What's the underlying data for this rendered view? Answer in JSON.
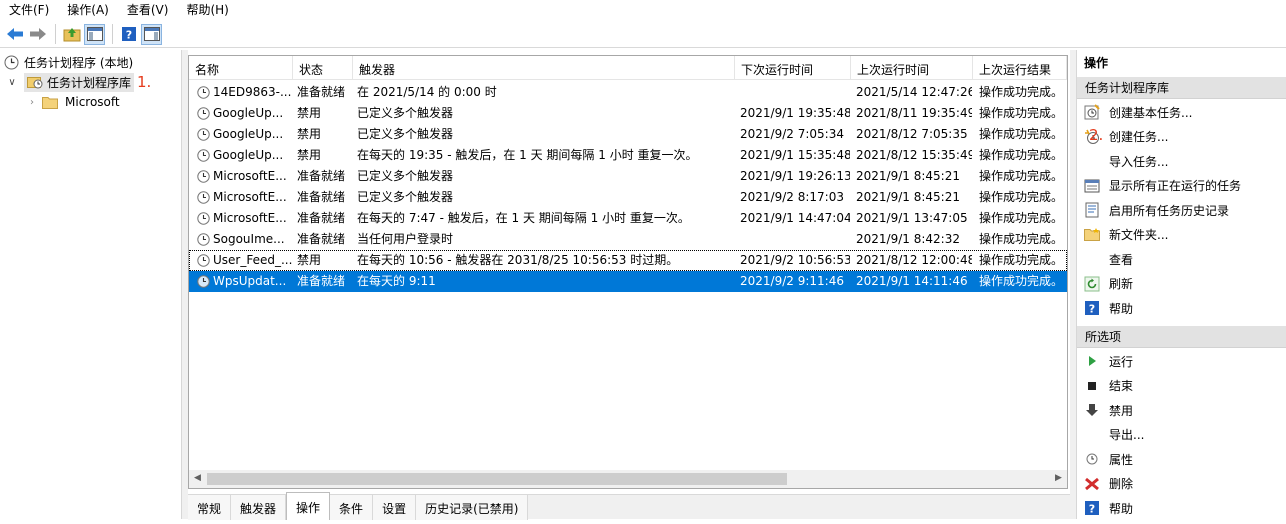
{
  "menu": [
    "文件(F)",
    "操作(A)",
    "查看(V)",
    "帮助(H)"
  ],
  "tree": {
    "root": "任务计划程序 (本地)",
    "library": "任务计划程序库",
    "library_annotation": "1.",
    "microsoft": "Microsoft"
  },
  "table": {
    "headers": [
      "名称",
      "状态",
      "触发器",
      "下次运行时间",
      "上次运行时间",
      "上次运行结果"
    ],
    "rows": [
      [
        "14ED9863-...",
        "准备就绪",
        "在 2021/5/14 的 0:00 时",
        "",
        "2021/5/14 12:47:26",
        "操作成功完成。"
      ],
      [
        "GoogleUp...",
        "禁用",
        "已定义多个触发器",
        "2021/9/1 19:35:48",
        "2021/8/11 19:35:49",
        "操作成功完成。"
      ],
      [
        "GoogleUp...",
        "禁用",
        "已定义多个触发器",
        "2021/9/2 7:05:34",
        "2021/8/12 7:05:35",
        "操作成功完成。"
      ],
      [
        "GoogleUp...",
        "禁用",
        "在每天的 19:35 - 触发后，在 1 天 期间每隔 1 小时 重复一次。",
        "2021/9/1 15:35:48",
        "2021/8/12 15:35:49",
        "操作成功完成。"
      ],
      [
        "MicrosoftE...",
        "准备就绪",
        "已定义多个触发器",
        "2021/9/1 19:26:13",
        "2021/9/1 8:45:21",
        "操作成功完成。"
      ],
      [
        "MicrosoftE...",
        "准备就绪",
        "已定义多个触发器",
        "2021/9/2 8:17:03",
        "2021/9/1 8:45:21",
        "操作成功完成。"
      ],
      [
        "MicrosoftE...",
        "准备就绪",
        "在每天的 7:47 - 触发后，在 1 天 期间每隔 1 小时 重复一次。",
        "2021/9/1 14:47:04",
        "2021/9/1 13:47:05",
        "操作成功完成。"
      ],
      [
        "SogouIme...",
        "准备就绪",
        "当任何用户登录时",
        "",
        "2021/9/1 8:42:32",
        "操作成功完成。"
      ],
      [
        "User_Feed_...",
        "禁用",
        "在每天的 10:56 - 触发器在 2031/8/25 10:56:53 时过期。",
        "2021/9/2 10:56:53",
        "2021/8/12 12:00:48",
        "操作成功完成。"
      ],
      [
        "WpsUpdat...",
        "准备就绪",
        "在每天的 9:11",
        "2021/9/2 9:11:46",
        "2021/9/1 14:11:46",
        "操作成功完成。"
      ]
    ],
    "selected_row": 9
  },
  "tabs": [
    "常规",
    "触发器",
    "操作",
    "条件",
    "设置",
    "历史记录(已禁用)"
  ],
  "active_tab": 2,
  "actions": {
    "title": "操作",
    "section1": "任务计划程序库",
    "items1": [
      {
        "label": "创建基本任务...",
        "icon": "create-basic-task-icon"
      },
      {
        "label": "创建任务...",
        "icon": "create-task-icon",
        "annotation": "2."
      },
      {
        "label": "导入任务...",
        "icon": ""
      },
      {
        "label": "显示所有正在运行的任务",
        "icon": "running-tasks-icon"
      },
      {
        "label": "启用所有任务历史记录",
        "icon": "history-icon"
      },
      {
        "label": "新文件夹...",
        "icon": "folder-icon"
      },
      {
        "label": "查看",
        "icon": ""
      },
      {
        "label": "刷新",
        "icon": "refresh-icon"
      },
      {
        "label": "帮助",
        "icon": "help-icon"
      }
    ],
    "section2": "所选项",
    "items2": [
      {
        "label": "运行",
        "icon": "run-icon"
      },
      {
        "label": "结束",
        "icon": "stop-icon"
      },
      {
        "label": "禁用",
        "icon": "disable-icon"
      },
      {
        "label": "导出...",
        "icon": ""
      },
      {
        "label": "属性",
        "icon": "properties-icon"
      },
      {
        "label": "删除",
        "icon": "delete-icon"
      },
      {
        "label": "帮助",
        "icon": "help-icon"
      }
    ]
  },
  "colors": {
    "selection": "#0078d7",
    "annotation": "#e53b1c"
  }
}
